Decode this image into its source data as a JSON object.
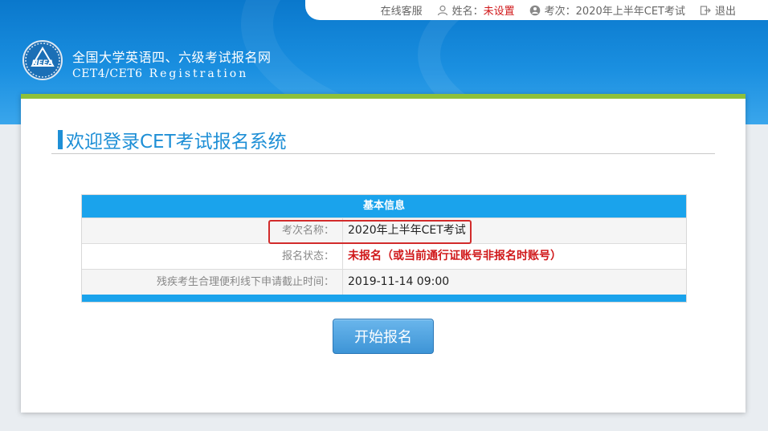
{
  "topbar": {
    "service": "在线客服",
    "name_label": "姓名：",
    "name_value": "未设置",
    "exam_label": "考次：",
    "exam_value": "2020年上半年CET考试",
    "logout": "退出"
  },
  "brand": {
    "title_cn": "全国大学英语四、六级考试报名网",
    "title_en": "CET4/CET6",
    "title_en_reg": "Registration",
    "logo_text": "NEEA"
  },
  "welcome": "欢迎登录CET考试报名系统",
  "info": {
    "heading": "基本信息",
    "rows": [
      {
        "label": "考次名称：",
        "value": "2020年上半年CET考试"
      },
      {
        "label": "报名状态：",
        "value": "未报名（或当前通行证账号非报名时账号）"
      },
      {
        "label": "残疾考生合理便利线下申请截止时间：",
        "value": "2019-11-14 09:00"
      }
    ]
  },
  "start_button": "开始报名",
  "colors": {
    "primary": "#1e8fd6",
    "table_header": "#1aa3ec",
    "accent_green": "#8ec03a",
    "warning": "#d0181a"
  },
  "icons": [
    "user-icon",
    "exam-icon",
    "logout-icon",
    "neea-logo-icon"
  ]
}
